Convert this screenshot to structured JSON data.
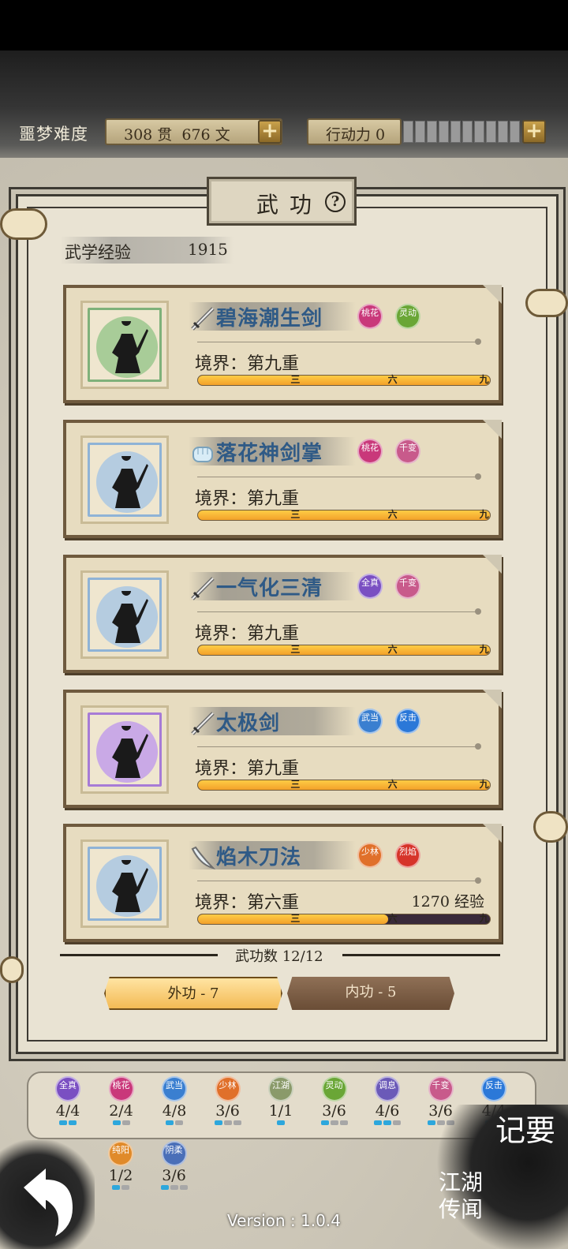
{
  "status": {
    "difficulty": "噩梦难度",
    "coins": "308 贯  676 文",
    "stamina": "行动力 0"
  },
  "panel": {
    "title": "武功",
    "help": "?"
  },
  "exp": {
    "label": "武学经验",
    "value": "1915"
  },
  "skills": [
    {
      "name": "碧海潮生剑",
      "realm": "境界：第九重",
      "progress": 1.0,
      "weapon": "sword-icon",
      "color": "#7fb17a",
      "disc": "#a8cc98",
      "tags": [
        {
          "t": "桃花",
          "c": "#c9387a"
        },
        {
          "t": "灵动",
          "c": "#6aa636"
        }
      ]
    },
    {
      "name": "落花神剑掌",
      "realm": "境界：第九重",
      "progress": 1.0,
      "weapon": "fist-icon",
      "color": "#8fb3d6",
      "disc": "#b5cce0",
      "tags": [
        {
          "t": "桃花",
          "c": "#c9387a"
        },
        {
          "t": "千变",
          "c": "#c85a8b"
        }
      ]
    },
    {
      "name": "一气化三清",
      "realm": "境界：第九重",
      "progress": 1.0,
      "weapon": "sword-icon",
      "color": "#8fb3d6",
      "disc": "#b5cce0",
      "tags": [
        {
          "t": "全真",
          "c": "#7a4fc2"
        },
        {
          "t": "千变",
          "c": "#c85a8b"
        }
      ]
    },
    {
      "name": "太极剑",
      "realm": "境界：第九重",
      "progress": 1.0,
      "weapon": "sword-icon",
      "color": "#a77bd6",
      "disc": "#c9a9e6",
      "tags": [
        {
          "t": "武当",
          "c": "#3a7fd0"
        },
        {
          "t": "反击",
          "c": "#2b78d8"
        }
      ]
    },
    {
      "name": "焰木刀法",
      "realm": "境界：第六重",
      "progress": 0.65,
      "exp_need": "1270 经验",
      "weapon": "blade-icon",
      "color": "#8fb3d6",
      "disc": "#b5cce0",
      "tags": [
        {
          "t": "少林",
          "c": "#e0702a"
        },
        {
          "t": "烈焰",
          "c": "#d6342a"
        }
      ]
    }
  ],
  "bar_marks": [
    "三",
    "六",
    "九"
  ],
  "count": "武功数 12/12",
  "tabs": {
    "external": "外功 - 7",
    "internal": "内功 - 5"
  },
  "sects": [
    {
      "t": "全真",
      "c": "#7a4fc2",
      "cnt": "4/4",
      "on": 2,
      "of": 2
    },
    {
      "t": "桃花",
      "c": "#c9387a",
      "cnt": "2/4",
      "on": 1,
      "of": 2
    },
    {
      "t": "武当",
      "c": "#3a7fd0",
      "cnt": "4/8",
      "on": 1,
      "of": 2
    },
    {
      "t": "少林",
      "c": "#e0702a",
      "cnt": "3/6",
      "on": 1,
      "of": 3
    },
    {
      "t": "江湖",
      "c": "#8a9a6a",
      "cnt": "1/1",
      "on": 1,
      "of": 1
    },
    {
      "t": "灵动",
      "c": "#6aa636",
      "cnt": "3/6",
      "on": 1,
      "of": 3
    },
    {
      "t": "调息",
      "c": "#6b5ab8",
      "cnt": "4/6",
      "on": 2,
      "of": 3
    },
    {
      "t": "千变",
      "c": "#c85a8b",
      "cnt": "3/6",
      "on": 1,
      "of": 3
    },
    {
      "t": "反击",
      "c": "#2b78d8",
      "cnt": "4/4",
      "on": 1,
      "of": 2
    },
    {
      "t": "纯阳",
      "c": "#e08a2a",
      "cnt": "1/2",
      "on": 1,
      "of": 2
    },
    {
      "t": "阴柔",
      "c": "#4a6fb8",
      "cnt": "3/6",
      "on": 1,
      "of": 3
    }
  ],
  "side_buttons": {
    "jiyao": "记要",
    "jianghu": "江湖传闻"
  },
  "version": "Version : 1.0.4"
}
